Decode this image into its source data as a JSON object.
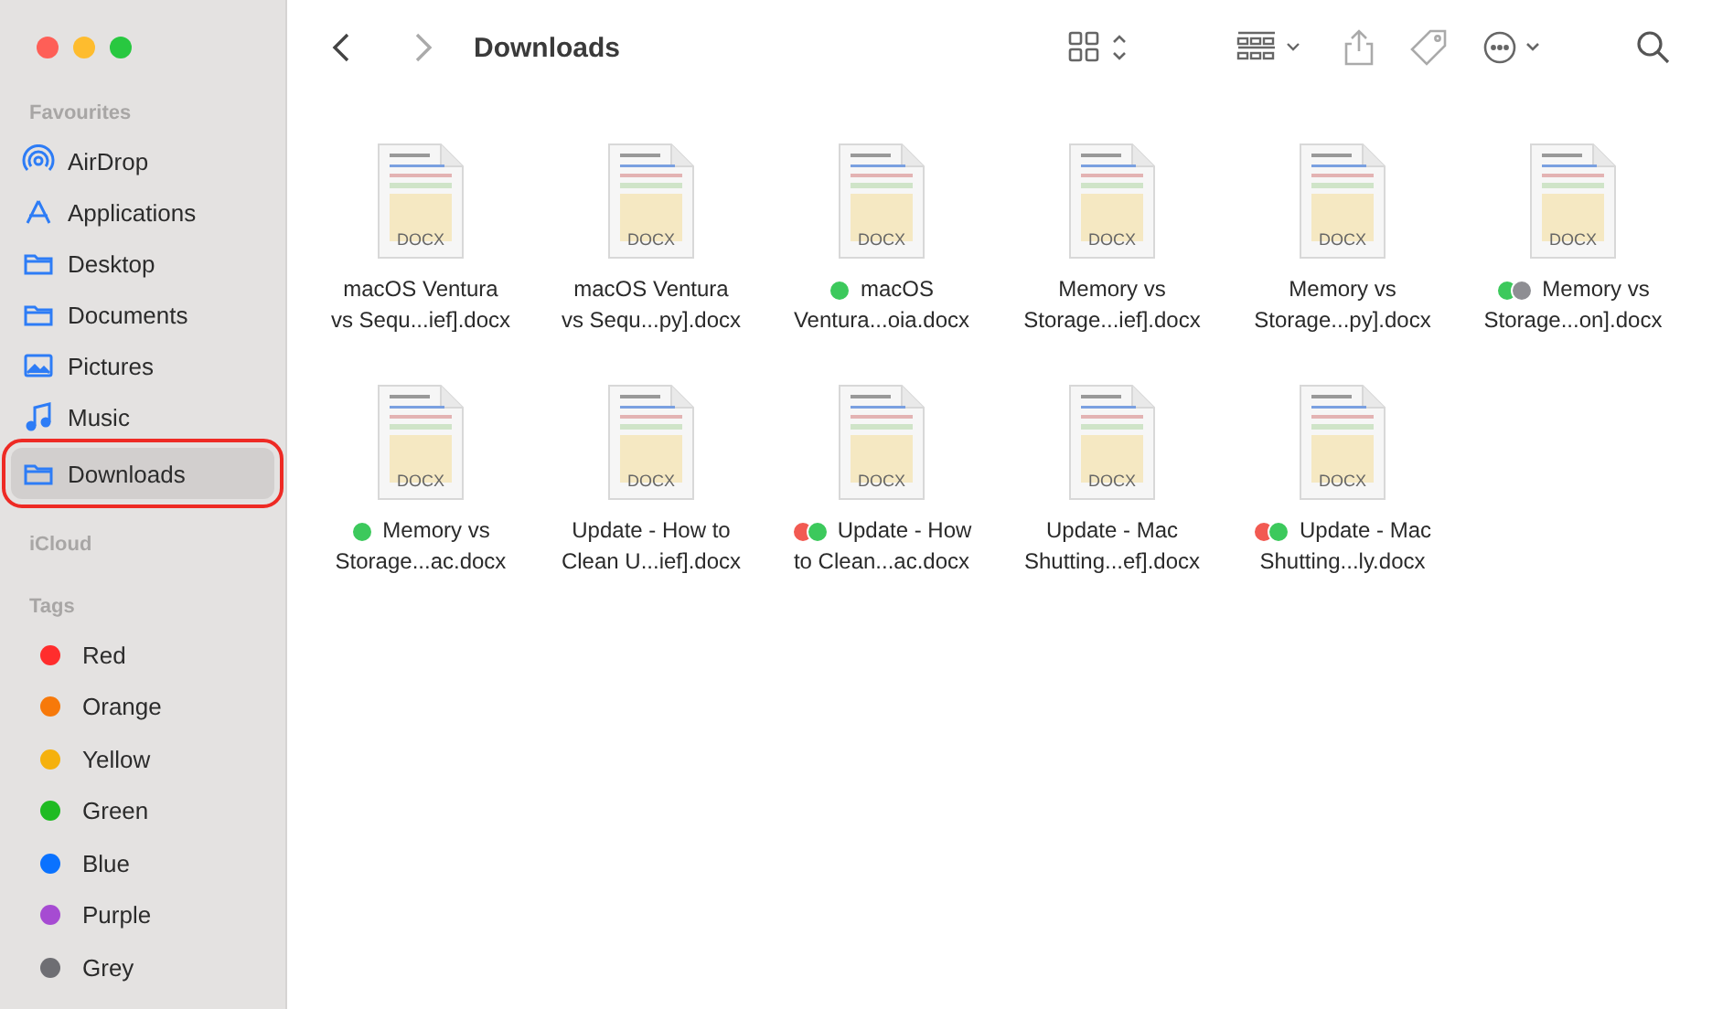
{
  "window": {
    "title": "Downloads"
  },
  "sidebar": {
    "sections": [
      {
        "heading": "Favourites",
        "items": [
          {
            "label": "AirDrop",
            "selected": false,
            "annotated": false
          },
          {
            "label": "Applications",
            "selected": false,
            "annotated": false
          },
          {
            "label": "Desktop",
            "selected": false,
            "annotated": false
          },
          {
            "label": "Documents",
            "selected": false,
            "annotated": false
          },
          {
            "label": "Pictures",
            "selected": false,
            "annotated": false
          },
          {
            "label": "Music",
            "selected": false,
            "annotated": false
          },
          {
            "label": "Downloads",
            "selected": true,
            "annotated": true
          }
        ]
      },
      {
        "heading": "iCloud"
      },
      {
        "heading": "Tags",
        "tags": [
          {
            "label": "Red",
            "color": "#ff2d2d"
          },
          {
            "label": "Orange",
            "color": "#f7790a"
          },
          {
            "label": "Yellow",
            "color": "#f5b10c"
          },
          {
            "label": "Green",
            "color": "#1fbb22"
          },
          {
            "label": "Blue",
            "color": "#0a72ff"
          },
          {
            "label": "Purple",
            "color": "#a64bd2"
          },
          {
            "label": "Grey",
            "color": "#6e6e73"
          }
        ]
      }
    ]
  },
  "files": [
    {
      "lines": [
        "macOS Ventura",
        "vs Sequ...ief].docx"
      ],
      "badge": "DOCX"
    },
    {
      "lines": [
        "macOS Ventura",
        "vs Sequ...py].docx"
      ],
      "badge": "DOCX"
    },
    {
      "lines": [
        "macOS",
        "Ventura...oia.docx"
      ],
      "badge": "DOCX",
      "tags": [
        {
          "color": "#3cc95c"
        }
      ]
    },
    {
      "lines": [
        "Memory vs",
        "Storage...ief].docx"
      ],
      "badge": "DOCX"
    },
    {
      "lines": [
        "Memory vs",
        "Storage...py].docx"
      ],
      "badge": "DOCX"
    },
    {
      "lines": [
        "Memory vs",
        "Storage...on].docx"
      ],
      "badge": "DOCX",
      "tags": [
        {
          "color": "#3cc95c"
        },
        {
          "color": "#8e8e93"
        }
      ]
    },
    {
      "lines": [
        "Memory vs",
        "Storage...ac.docx"
      ],
      "badge": "DOCX",
      "tags": [
        {
          "color": "#3cc95c"
        }
      ]
    },
    {
      "lines": [
        "Update - How to",
        "Clean U...ief].docx"
      ],
      "badge": "DOCX"
    },
    {
      "lines": [
        "Update - How",
        "to Clean...ac.docx"
      ],
      "badge": "DOCX",
      "tags": [
        {
          "color": "#f25a52"
        },
        {
          "color": "#3cc95c"
        }
      ]
    },
    {
      "lines": [
        "Update - Mac",
        "Shutting...ef].docx"
      ],
      "badge": "DOCX"
    },
    {
      "lines": [
        "Update - Mac",
        "Shutting...ly.docx"
      ],
      "badge": "DOCX",
      "tags": [
        {
          "color": "#f25a52"
        },
        {
          "color": "#3cc95c"
        }
      ]
    }
  ]
}
